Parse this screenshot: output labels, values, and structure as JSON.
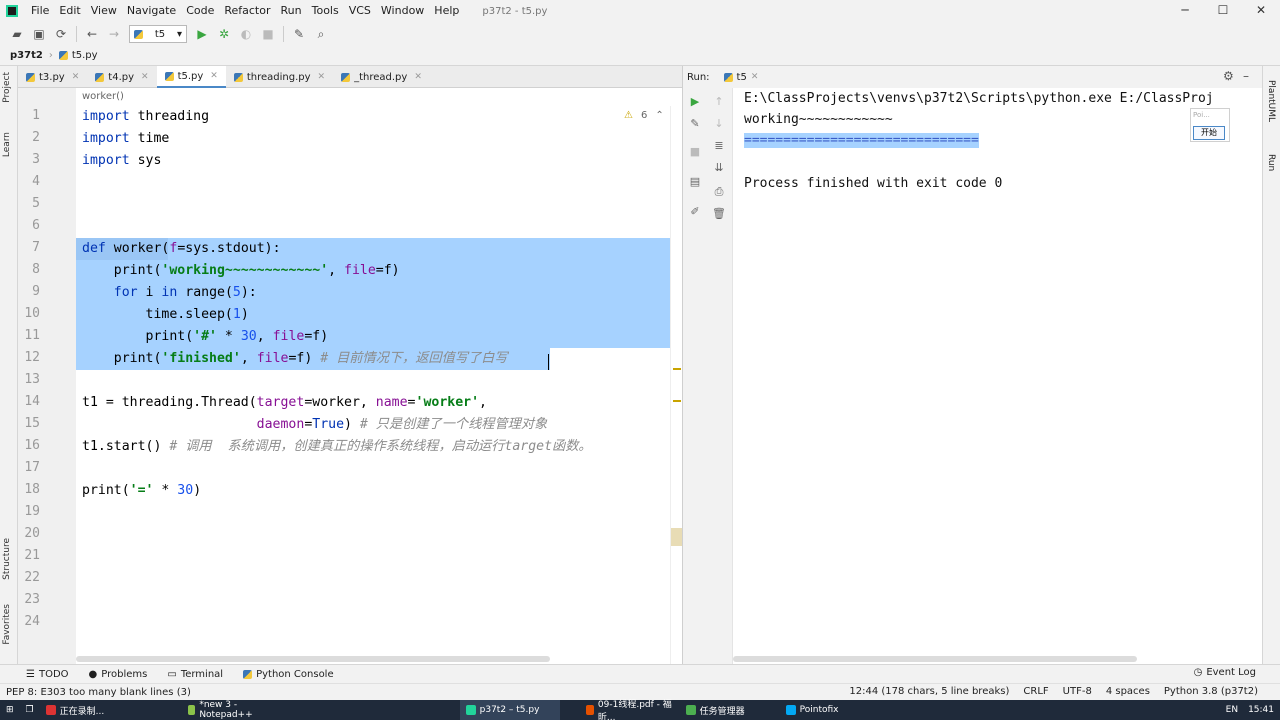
{
  "window": {
    "title": "p37t2 - t5.py",
    "controls": [
      "─",
      "☐",
      "✕"
    ]
  },
  "menu": [
    "File",
    "Edit",
    "View",
    "Navigate",
    "Code",
    "Refactor",
    "Run",
    "Tools",
    "VCS",
    "Window",
    "Help"
  ],
  "toolbar": {
    "run_config": "t5"
  },
  "breadcrumb": {
    "project": "p37t2",
    "file": "t5.py"
  },
  "left_strip": [
    "Project",
    "Learn",
    "Structure",
    "Favorites"
  ],
  "right_strip": [
    "PlantUML",
    "Run"
  ],
  "editor": {
    "tabs": [
      {
        "label": "t3.py",
        "active": false
      },
      {
        "label": "t4.py",
        "active": false
      },
      {
        "label": "t5.py",
        "active": true
      },
      {
        "label": "threading.py",
        "active": false
      },
      {
        "label": "_thread.py",
        "active": false
      }
    ],
    "crumb": "worker()",
    "inspection_count": "6",
    "line_numbers": [
      "1",
      "2",
      "3",
      "4",
      "5",
      "6",
      "7",
      "8",
      "9",
      "10",
      "11",
      "12",
      "13",
      "14",
      "15",
      "16",
      "17",
      "18",
      "19",
      "20",
      "21",
      "22",
      "23",
      "24"
    ]
  },
  "run": {
    "label": "Run:",
    "tab": "t5",
    "output": [
      "E:\\ClassProjects\\venvs\\p37t2\\Scripts\\python.exe E:/ClassProj",
      "working~~~~~~~~~~~~",
      "==============================",
      "",
      "Process finished with exit code 0"
    ],
    "popup_label": "Poi...",
    "popup_button": "开始"
  },
  "toolwindows": [
    "TODO",
    "Problems",
    "Terminal",
    "Python Console"
  ],
  "event_log": "Event Log",
  "status": {
    "message": "PEP 8: E303 too many blank lines (3)",
    "position": "12:44 (178 chars, 5 line breaks)",
    "line_sep": "CRLF",
    "encoding": "UTF-8",
    "indent": "4 spaces",
    "interpreter": "Python 3.8 (p37t2)"
  },
  "taskbar": {
    "items": [
      "正在录制...",
      "*new 3 - Notepad++",
      "p37t2 – t5.py",
      "09-1线程.pdf - 福昕...",
      "任务管理器",
      "Pointofix"
    ],
    "clock": "15:41",
    "lang": "EN"
  },
  "colors": {
    "selection": "#a6d2ff",
    "keyword": "#0033b3",
    "string": "#067d17",
    "comment": "#8c8c8c",
    "param": "#871094"
  }
}
